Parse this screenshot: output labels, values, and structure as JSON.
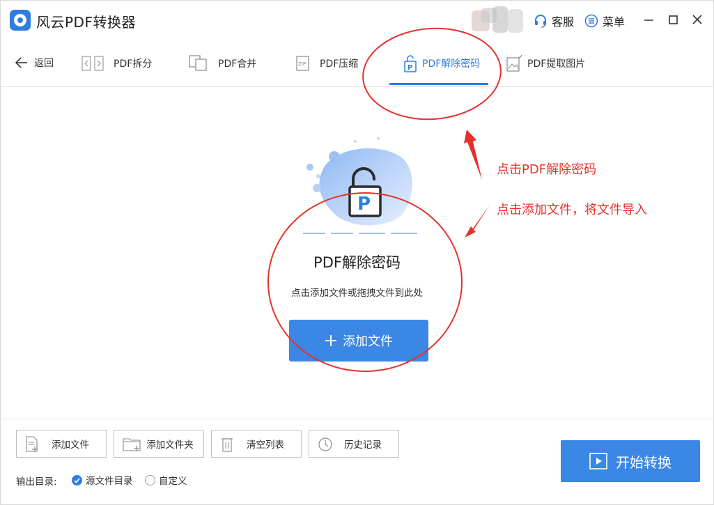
{
  "app": {
    "title": "风云PDF转换器"
  },
  "titlebar": {
    "service_label": "客服",
    "menu_label": "菜单"
  },
  "nav": {
    "back_label": "返回",
    "tabs": [
      {
        "label": "PDF拆分",
        "icon": "split-icon"
      },
      {
        "label": "PDF合并",
        "icon": "merge-icon"
      },
      {
        "label": "PDF压缩",
        "icon": "zip-icon"
      },
      {
        "label": "PDF解除密码",
        "icon": "unlock-pdf-icon",
        "active": true
      },
      {
        "label": "PDF提取图片",
        "icon": "image-extract-icon"
      }
    ]
  },
  "main": {
    "title": "PDF解除密码",
    "subtitle": "点击添加文件或拖拽文件到此处",
    "add_file_label": "添加文件"
  },
  "annotations": {
    "step1": "点击PDF解除密码",
    "step2": "点击添加文件，将文件导入"
  },
  "toolbar": {
    "add_file": "添加文件",
    "add_folder": "添加文件夹",
    "clear_list": "清空列表",
    "history": "历史记录"
  },
  "output": {
    "label": "输出目录:",
    "options": [
      {
        "label": "源文件目录",
        "selected": true
      },
      {
        "label": "自定义",
        "selected": false
      }
    ]
  },
  "start_label": "开始转换",
  "colors": {
    "accent": "#3b87e6",
    "annotation": "#e4322b"
  }
}
